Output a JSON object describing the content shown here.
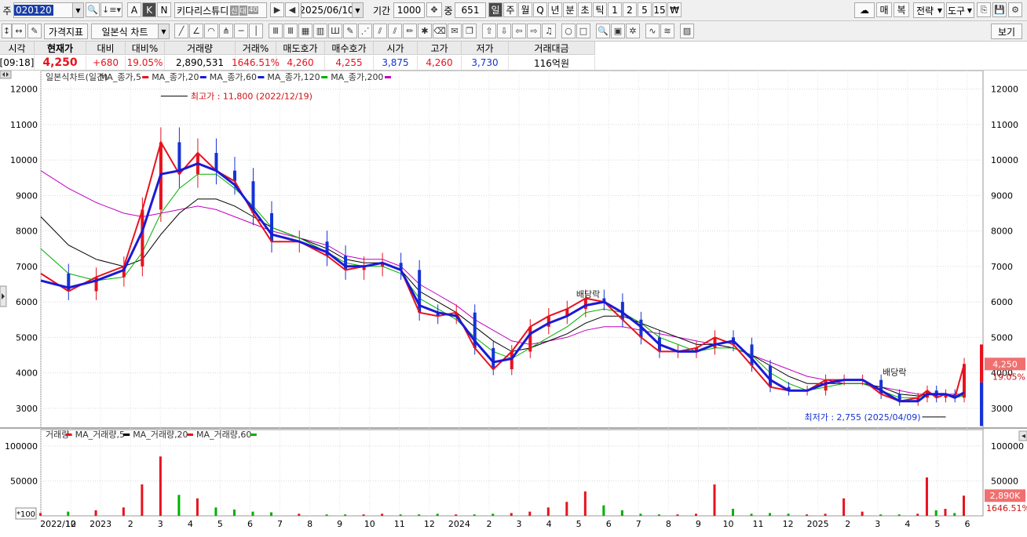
{
  "toolbar": {
    "market_label": "주",
    "symbol": "020120",
    "symbol_badges": [
      "신",
      "대",
      "40"
    ],
    "buttons_a": [
      "A",
      "K",
      "N"
    ],
    "stock_name": "키다리스튜디",
    "date": "2025/06/10",
    "period_label": "기간",
    "period_value": "1000",
    "center_value": "651",
    "center_prefix": "중",
    "periods": [
      "일",
      "주",
      "월",
      "Q",
      "년",
      "분",
      "초",
      "틱",
      "1",
      "2",
      "5",
      "15",
      "₩"
    ],
    "selected_period": "일",
    "right_buttons": [
      "매",
      "복",
      "전략",
      "도구"
    ],
    "indicator_btn": "가격지표",
    "chart_type": "일본식 차트",
    "view_btn": "보기"
  },
  "quote": {
    "headers": [
      "시각",
      "현재가",
      "대비",
      "대비%",
      "거래량",
      "거래%",
      "매도호가",
      "매수호가",
      "시가",
      "고가",
      "저가",
      "거래대금"
    ],
    "values": [
      "[09:18]",
      "4,250",
      "+680",
      "19.05%",
      "2,890,531",
      "1646.51%",
      "4,260",
      "4,255",
      "3,875",
      "4,260",
      "3,730",
      "116억원"
    ]
  },
  "colors": {
    "up": "#e8121d",
    "down": "#1533d6",
    "ma5": "#e8121d",
    "ma20": "#1a1ad6",
    "ma60": "#00b000",
    "ma120": "#000000",
    "ma200": "#c000c0"
  },
  "legend": {
    "price": [
      "일본식차트(일간)",
      "MA_종가,5",
      "MA_종가,20",
      "MA_종가,60",
      "MA_종가,120",
      "MA_종가,200"
    ],
    "volume": [
      "거래량",
      "MA_거래량,5",
      "MA_거래량,20",
      "MA_거래량,60"
    ]
  },
  "annotations": {
    "high": "최고가 : 11,800 (2022/12/19)",
    "low": "최저가 : 2,755 (2025/04/09)",
    "dividend": "배당락",
    "current_price": "4,250",
    "current_pct": "19.05%",
    "vol_current": "2,890K",
    "vol_pct": "1646.51%",
    "vol_unit": "*100"
  },
  "chart_data": {
    "type": "candlestick",
    "ylim": [
      2400,
      12300
    ],
    "yticks": [
      3000,
      4000,
      5000,
      6000,
      7000,
      8000,
      9000,
      10000,
      11000,
      12000
    ],
    "vol_ylim": [
      0,
      110000
    ],
    "vol_yticks": [
      50000,
      100000
    ],
    "xtick_labels": [
      "2022/10",
      "12",
      "2023",
      "2",
      "3",
      "4",
      "5",
      "6",
      "7",
      "8",
      "9",
      "10",
      "11",
      "12",
      "2024",
      "2",
      "3",
      "4",
      "5",
      "6",
      "7",
      "8",
      "9",
      "10",
      "11",
      "12",
      "2025",
      "2",
      "3",
      "4",
      "5",
      "6"
    ],
    "x": [
      0,
      0.03,
      0.06,
      0.09,
      0.11,
      0.13,
      0.15,
      0.17,
      0.19,
      0.21,
      0.23,
      0.25,
      0.28,
      0.31,
      0.33,
      0.35,
      0.37,
      0.39,
      0.41,
      0.43,
      0.45,
      0.47,
      0.49,
      0.51,
      0.53,
      0.55,
      0.57,
      0.59,
      0.61,
      0.63,
      0.65,
      0.67,
      0.69,
      0.71,
      0.73,
      0.75,
      0.77,
      0.79,
      0.81,
      0.83,
      0.85,
      0.87,
      0.89,
      0.91,
      0.93,
      0.95,
      0.96,
      0.97,
      0.98,
      0.99,
      1.0
    ],
    "close": [
      6800,
      6300,
      6700,
      7000,
      8600,
      10500,
      9600,
      10200,
      9700,
      9400,
      8500,
      7700,
      7700,
      7300,
      6900,
      7000,
      7100,
      6900,
      5700,
      5600,
      5700,
      4700,
      4100,
      4600,
      5300,
      5600,
      5800,
      6100,
      6000,
      5500,
      5000,
      4600,
      4600,
      4700,
      5000,
      4800,
      4200,
      3600,
      3500,
      3500,
      3800,
      3800,
      3800,
      3400,
      3200,
      3300,
      3500,
      3300,
      3400,
      3300,
      4250
    ],
    "ma20": [
      6600,
      6400,
      6600,
      6900,
      8000,
      9600,
      9700,
      9900,
      9700,
      9300,
      8600,
      7900,
      7700,
      7400,
      7000,
      7000,
      7100,
      6900,
      5900,
      5700,
      5600,
      4900,
      4300,
      4400,
      5100,
      5400,
      5600,
      5900,
      6000,
      5700,
      5300,
      4800,
      4600,
      4600,
      4800,
      4900,
      4400,
      3800,
      3500,
      3500,
      3700,
      3800,
      3800,
      3500,
      3200,
      3200,
      3400,
      3400,
      3400,
      3300,
      3450
    ],
    "ma60": [
      7500,
      6800,
      6600,
      6700,
      7400,
      8500,
      9200,
      9600,
      9600,
      9200,
      8700,
      8100,
      7800,
      7400,
      7100,
      7000,
      7000,
      6800,
      6100,
      5800,
      5500,
      5000,
      4600,
      4400,
      4700,
      5000,
      5300,
      5700,
      5800,
      5700,
      5400,
      5000,
      4800,
      4600,
      4700,
      4700,
      4500,
      4000,
      3700,
      3500,
      3600,
      3700,
      3700,
      3500,
      3300,
      3300,
      3400,
      3400,
      3400,
      3300,
      3350
    ],
    "ma120": [
      8400,
      7600,
      7200,
      7000,
      7200,
      7900,
      8500,
      8900,
      8900,
      8700,
      8400,
      8100,
      7800,
      7500,
      7200,
      7100,
      7100,
      6900,
      6300,
      6000,
      5700,
      5300,
      4900,
      4600,
      4700,
      4900,
      5100,
      5400,
      5600,
      5600,
      5400,
      5200,
      5000,
      4800,
      4800,
      4700,
      4500,
      4200,
      3900,
      3700,
      3700,
      3700,
      3700,
      3600,
      3400,
      3350,
      3400,
      3400,
      3400,
      3350,
      3380
    ],
    "ma200": [
      9700,
      9200,
      8800,
      8500,
      8400,
      8500,
      8600,
      8700,
      8600,
      8400,
      8200,
      8000,
      7800,
      7600,
      7300,
      7200,
      7200,
      7000,
      6500,
      6200,
      5900,
      5500,
      5200,
      4900,
      4800,
      4900,
      5000,
      5200,
      5300,
      5300,
      5200,
      5100,
      5000,
      4900,
      4800,
      4700,
      4500,
      4300,
      4100,
      3900,
      3800,
      3700,
      3700,
      3600,
      3500,
      3400,
      3400,
      3400,
      3400,
      3400,
      3400
    ],
    "volume": [
      4000,
      6000,
      8000,
      12000,
      45000,
      85000,
      30000,
      25000,
      12000,
      9000,
      6000,
      5000,
      3000,
      2000,
      2000,
      2000,
      3000,
      2000,
      2000,
      3000,
      2000,
      2000,
      3000,
      4000,
      6000,
      12000,
      20000,
      35000,
      15000,
      8000,
      3000,
      2000,
      2000,
      3000,
      45000,
      10000,
      3000,
      4000,
      3000,
      2000,
      3000,
      25000,
      6000,
      2000,
      2000,
      3000,
      55000,
      8000,
      10000,
      4000,
      28905
    ],
    "high_idx": 5,
    "low_idx": 48
  }
}
